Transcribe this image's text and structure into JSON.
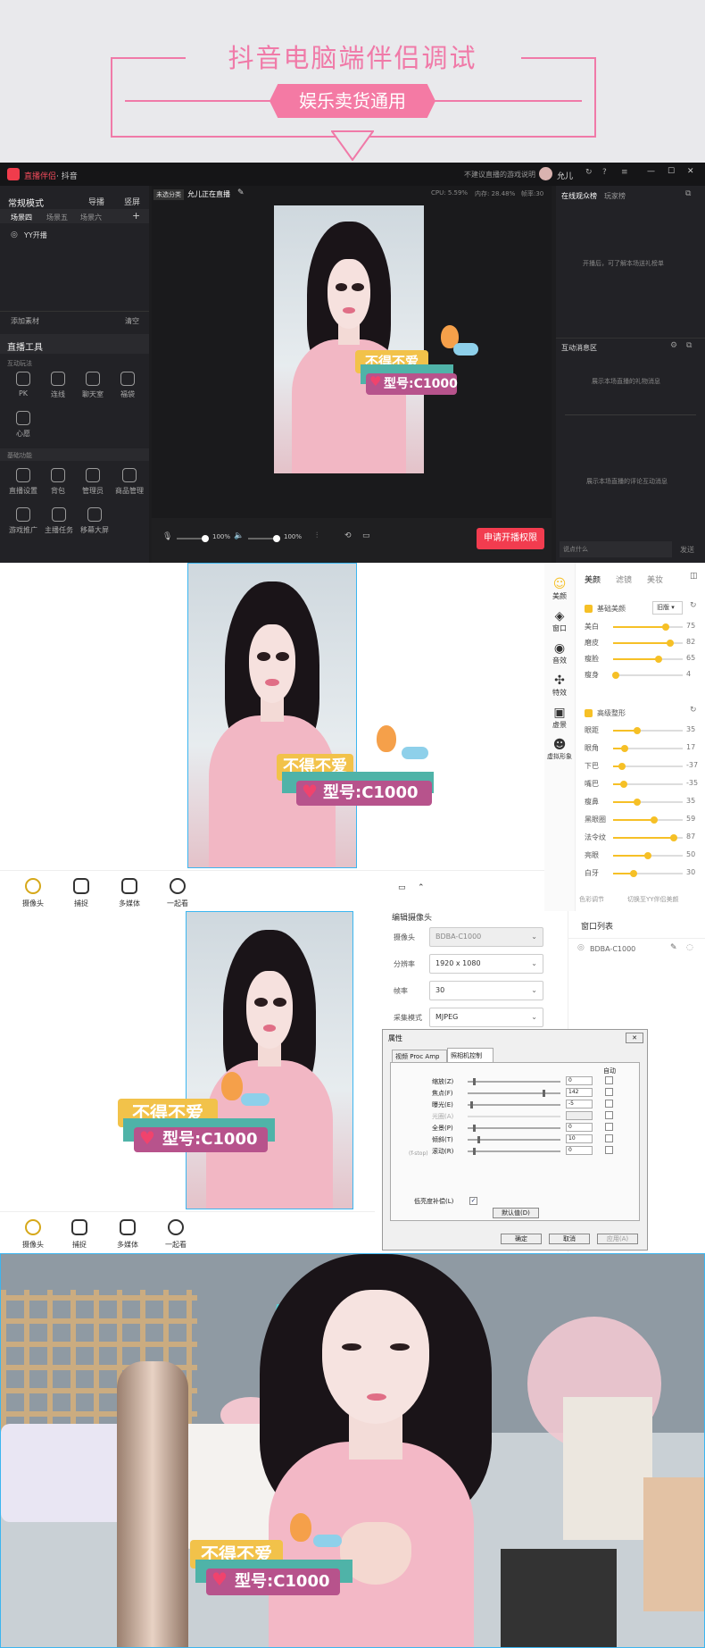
{
  "header": {
    "title": "抖音电脑端伴侣调试",
    "pill": "娱乐卖货通用"
  },
  "app": {
    "title_app": "直播伴侣",
    "title_sep": " · 抖音",
    "notice": "不建议直播的游戏说明",
    "user": "允儿",
    "mode": "常规模式",
    "guide": "导播",
    "landscape": "竖屏",
    "scene_tabs": [
      "场景四",
      "场景五",
      "场景六"
    ],
    "source": "YY开播",
    "add_material": "添加素材",
    "clear": "清空",
    "tools_title": "直播工具",
    "interact_title": "互动玩法",
    "tools_row1": [
      "PK",
      "连线",
      "聊天室",
      "福袋"
    ],
    "tools_row1b": [
      "心愿"
    ],
    "basic_title": "基础功能",
    "tools_row2": [
      "直播设置",
      "背包",
      "管理员",
      "商品管理"
    ],
    "tools_row3": [
      "游戏推广",
      "主播任务",
      "移幕大屏"
    ],
    "category": "未选分类",
    "live_status": "允儿正在直播",
    "cpu": "CPU: 5.59%",
    "mem": "内存: 28.48%",
    "fps": "帧率:30",
    "mic_vol": "100%",
    "spk_vol": "100%",
    "apply_btn": "申请开播权限",
    "right_tabs": [
      "在线观众榜",
      "玩家榜"
    ],
    "right_hint": "开播后，可了解本场送礼榜单",
    "interact_msg": "互动消息区",
    "gift_hint": "展示本场直播的礼物消息",
    "comment_hint": "展示本场直播的评论互动消息",
    "input_ph": "说点什么",
    "send": "发送"
  },
  "sticker": {
    "line1": "不得不爱",
    "line2": "型号:C1000"
  },
  "beauty": {
    "tabs": [
      "美颜",
      "滤镜",
      "美妆"
    ],
    "side": [
      "美颜",
      "窗口",
      "音效",
      "特效",
      "虚景",
      "虚拟形象"
    ],
    "basic": "基础美颜",
    "version": "旧版",
    "basic_items": [
      {
        "label": "美白",
        "value": "75"
      },
      {
        "label": "磨皮",
        "value": "82"
      },
      {
        "label": "瘦脸",
        "value": "65"
      },
      {
        "label": "瘦身",
        "value": "4"
      }
    ],
    "advanced": "高级整形",
    "adv_items": [
      {
        "label": "眼距",
        "value": "35"
      },
      {
        "label": "眼角",
        "value": "17"
      },
      {
        "label": "下巴",
        "value": "-37"
      },
      {
        "label": "嘴巴",
        "value": "-35"
      },
      {
        "label": "瘦鼻",
        "value": "35"
      },
      {
        "label": "黑眼圈",
        "value": "59"
      },
      {
        "label": "法令纹",
        "value": "87"
      },
      {
        "label": "亮眼",
        "value": "50"
      },
      {
        "label": "白牙",
        "value": "30"
      }
    ],
    "color_adjust": "色彩调节",
    "switch_yy": "切换至YY伴侣美颜"
  },
  "bottom_bar": [
    "摄像头",
    "捕捉",
    "多媒体",
    "一起看"
  ],
  "camera": {
    "heading": "编辑摄像头",
    "rows": [
      {
        "label": "摄像头",
        "value": "BDBA-C1000"
      },
      {
        "label": "分辨率",
        "value": "1920 x 1080"
      },
      {
        "label": "帧率",
        "value": "30"
      },
      {
        "label": "采集模式",
        "value": "MJPEG"
      }
    ],
    "window_list": "窗口列表",
    "window_item": "BDBA-C1000"
  },
  "dialog": {
    "title": "属性",
    "tabs": [
      "视频 Proc Amp",
      "照相机控制"
    ],
    "auto": "自动",
    "rows": [
      {
        "label": "缩放(Z)",
        "value": "0"
      },
      {
        "label": "焦点(F)",
        "value": "142"
      },
      {
        "label": "曝光(E)",
        "value": "-5"
      },
      {
        "label": "光圈(A)",
        "value": ""
      },
      {
        "label": "全景(P)",
        "value": "0"
      },
      {
        "label": "倾斜(T)",
        "value": "10"
      },
      {
        "label": "滚动(R)",
        "value": "0"
      }
    ],
    "iris_note": "(f-stop)",
    "lowlight": "低亮度补偿(L)",
    "default_btn": "默认值(D)",
    "ok": "确定",
    "cancel": "取消",
    "apply": "应用(A)"
  }
}
